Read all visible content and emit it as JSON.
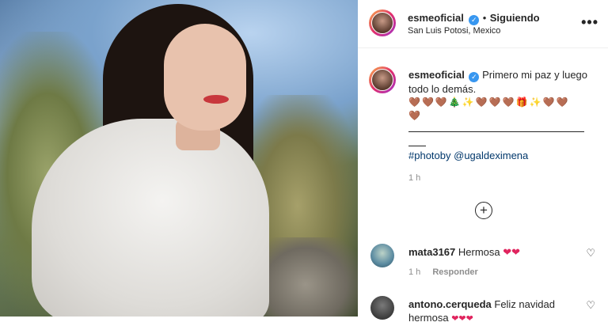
{
  "post": {
    "username": "esmeoficial",
    "verified_mark": "✓",
    "separator": "•",
    "follow_label": "Siguiendo",
    "location": "San Luis Potosi, Mexico",
    "more_icon": "more-horizontal-icon",
    "more_glyph": "•••"
  },
  "caption": {
    "username": "esmeoficial",
    "text": "Primero mi paz y luego todo lo demás.",
    "emojis": [
      "🤎",
      "🤎",
      "🤎",
      "🎄",
      "✨",
      "🤎",
      "🤎",
      "🤎",
      "🎁",
      "✨",
      "🤎",
      "🤎",
      "🤎"
    ],
    "tags": [
      "#photoby",
      "@ugaldeximena"
    ],
    "timestamp": "1 h"
  },
  "load_more_glyph": "+",
  "comments": [
    {
      "username": "mata3167",
      "text": "Hermosa",
      "hearts": "❤❤",
      "timestamp": "1 h",
      "reply_label": "Responder"
    },
    {
      "username": "antono.cerqueda",
      "text": "Feliz navidad hermosa",
      "hearts": "❤❤❤"
    }
  ],
  "like_glyph": "♡",
  "colors": {
    "verified": "#3897f0",
    "link": "#00376b",
    "heart": "#e0245e",
    "muted": "#8e8e8e"
  }
}
